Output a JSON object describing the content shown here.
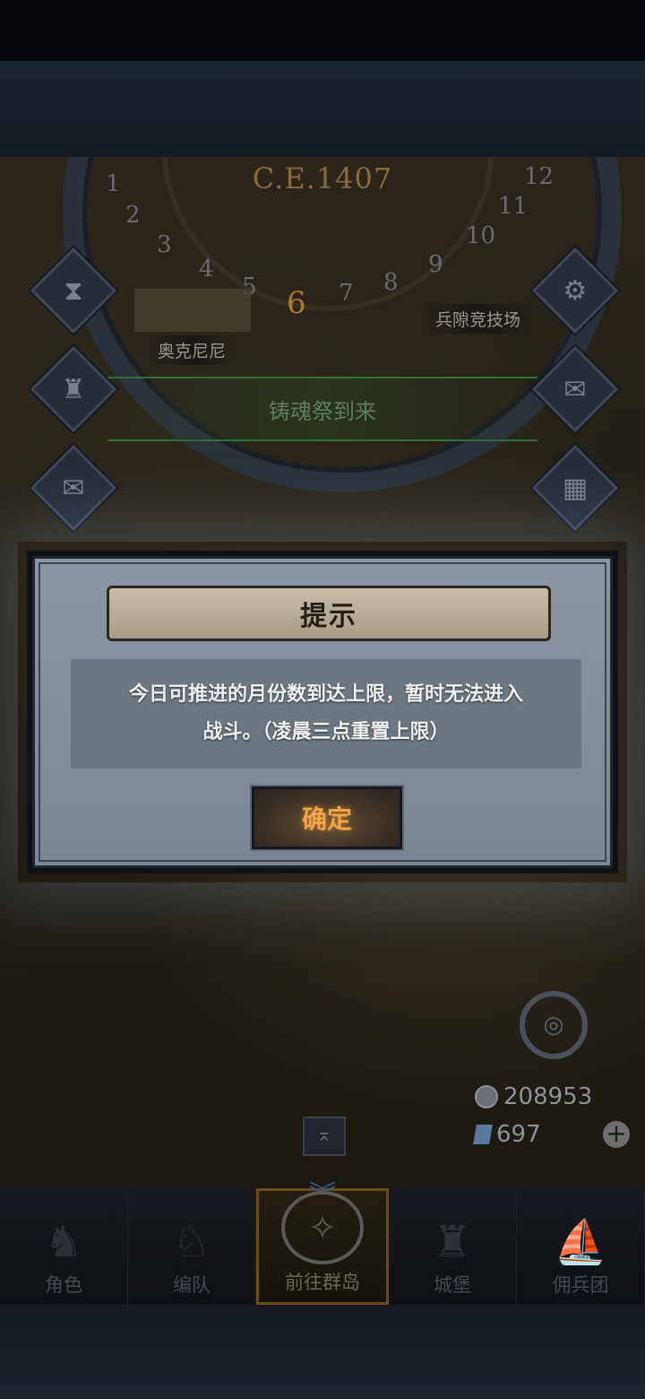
{
  "calendar": {
    "era": "C.E.1407",
    "months_left": [
      "1",
      "2",
      "3",
      "4",
      "5"
    ],
    "current_month": "6",
    "months_right": [
      "7",
      "8",
      "9",
      "10",
      "11",
      "12"
    ]
  },
  "map": {
    "place_left": "奥克尼尼",
    "place_right": "兵隙竞技场",
    "event_banner": "铸魂祭到来"
  },
  "currency": {
    "silver": "208953",
    "gems": "697"
  },
  "side_buttons": {
    "left_icons": [
      "hourglass-icon",
      "bag-icon",
      "scroll-icon"
    ],
    "right_icons": [
      "gear-icon",
      "mail-icon",
      "board-icon"
    ]
  },
  "dialog": {
    "title": "提示",
    "message_line1": "今日可推进的月份数到达上限，暂时无法进入",
    "message_line2": "战斗。（凌晨三点重置上限）",
    "confirm": "确定"
  },
  "nav": {
    "items": [
      {
        "label": "角色",
        "icon": "knight-icon"
      },
      {
        "label": "编队",
        "icon": "team-icon"
      },
      {
        "label": "前往群岛",
        "icon": "islands-icon"
      },
      {
        "label": "城堡",
        "icon": "castle-icon"
      },
      {
        "label": "佣兵团",
        "icon": "ship-icon"
      }
    ],
    "active_index": 2
  }
}
